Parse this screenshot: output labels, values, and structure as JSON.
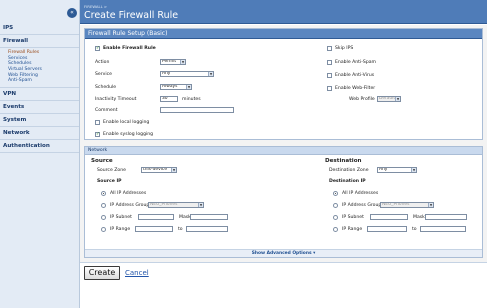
{
  "sidebar": {
    "collapse_icon": "«",
    "sections": {
      "ips": "IPS",
      "firewall": "Firewall",
      "vpn": "VPN",
      "events": "Events",
      "system": "System",
      "network": "Network",
      "authentication": "Authentication"
    },
    "firewall_items": {
      "rules": "Firewall Rules",
      "services": "Services",
      "schedules": "Schedules",
      "virtual_servers": "Virtual Servers",
      "web_filtering": "Web Filtering",
      "anti_spam": "Anti-Spam"
    }
  },
  "header": {
    "breadcrumb": "FIREWALL >",
    "title": "Create Firewall Rule"
  },
  "basic": {
    "title": "Firewall Rule Setup (Basic)",
    "enable_label": "Enable Firewall Rule",
    "enable_checked": true,
    "action_label": "Action",
    "action_value": "Permit",
    "service_label": "Service",
    "service_value": "Any",
    "schedule_label": "Schedule",
    "schedule_value": "Always",
    "timeout_label": "Inactivity Timeout",
    "timeout_value": "30",
    "timeout_unit": "minutes",
    "comment_label": "Comment",
    "comment_value": "",
    "local_logging_label": "Enable local logging",
    "local_logging_checked": false,
    "syslog_label": "Enable syslog logging",
    "syslog_checked": true,
    "skip_ips_label": "Skip IPS",
    "anti_spam_label": "Enable Anti-Spam",
    "anti_virus_label": "Enable Anti-Virus",
    "web_filter_label": "Enable Web-Filter",
    "web_profile_label": "Web Profile",
    "web_profile_value": "Default"
  },
  "network": {
    "title": "Network",
    "source": {
      "heading": "Source",
      "zone_label": "Source Zone",
      "zone_value": "this-device",
      "ip_heading": "Source IP",
      "all_label": "All IP Addresses",
      "group_label": "IP Address Group",
      "group_value": "NEU_Phones",
      "subnet_label": "IP Subnet",
      "mask_label": "Mask",
      "range_label": "IP Range",
      "to_label": "to"
    },
    "destination": {
      "heading": "Destination",
      "zone_label": "Destination Zone",
      "zone_value": "Any",
      "ip_heading": "Destination IP",
      "all_label": "All IP Addresses",
      "group_label": "IP Address Group",
      "group_value": "NEU_Phones",
      "subnet_label": "IP Subnet",
      "mask_label": "Mask",
      "range_label": "IP Range",
      "to_label": "to"
    },
    "advanced_link": "Show Advanced Options ▾"
  },
  "footer": {
    "create_label": "Create",
    "cancel_label": "Cancel"
  },
  "colors": {
    "header_blue": "#4f7cb8",
    "sidebar_bg": "#e3ebf5",
    "link_blue": "#1f4f91"
  }
}
